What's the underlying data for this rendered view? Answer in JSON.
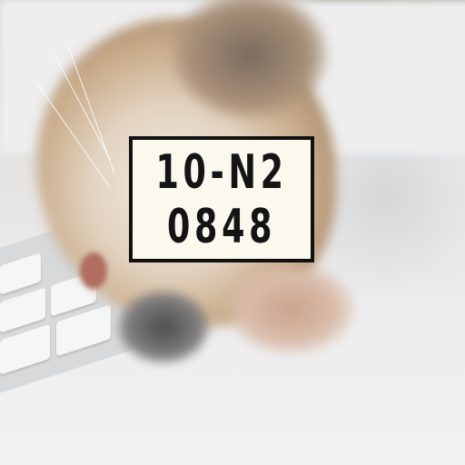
{
  "plate": {
    "line1": "10-N2",
    "line2": "0848"
  },
  "colors": {
    "plate_background": "#fbf8ee",
    "plate_text": "#141414"
  }
}
